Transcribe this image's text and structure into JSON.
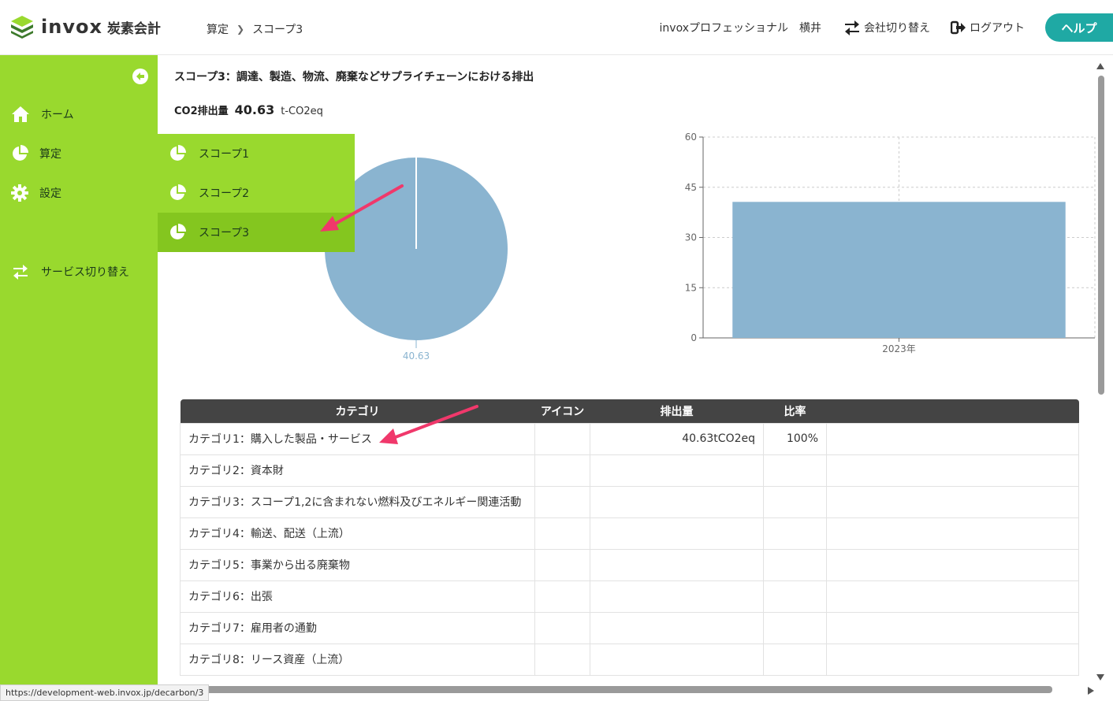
{
  "header": {
    "logo_word": "invox",
    "logo_sub": "炭素会計",
    "breadcrumb": [
      "算定",
      "スコープ3"
    ],
    "plan": "invoxプロフェッショナル",
    "user": "横井",
    "switch_company": "会社切り替え",
    "logout": "ログアウト",
    "help": "ヘルプ"
  },
  "sidebar": {
    "items": [
      {
        "label": "ホーム",
        "icon": "home-icon"
      },
      {
        "label": "算定",
        "icon": "pie-chart-icon"
      },
      {
        "label": "設定",
        "icon": "gear-icon"
      },
      {
        "label": "サービス切り替え",
        "icon": "switch-icon"
      }
    ],
    "submenu": [
      {
        "label": "スコープ1"
      },
      {
        "label": "スコープ2"
      },
      {
        "label": "スコープ3",
        "active": true
      }
    ]
  },
  "main": {
    "title": "スコープ3：調達、製造、物流、廃棄などサプライチェーンにおける排出",
    "co2_label": "CO2排出量",
    "co2_value": "40.63",
    "co2_unit": "t-CO2eq"
  },
  "chart_data": [
    {
      "type": "pie",
      "values": [
        40.63
      ],
      "labels": [
        "40.63"
      ],
      "color": "#8ab4d0"
    },
    {
      "type": "bar",
      "categories": [
        "2023年"
      ],
      "values": [
        40.63
      ],
      "ylim": [
        0,
        60
      ],
      "yticks": [
        0,
        15,
        30,
        45,
        60
      ],
      "grid": true,
      "color": "#8ab4d0"
    }
  ],
  "table": {
    "headers": [
      "カテゴリ",
      "アイコン",
      "排出量",
      "比率",
      ""
    ],
    "rows": [
      {
        "category": "カテゴリ1：購入した製品・サービス",
        "amount": "40.63tCO2eq",
        "ratio": "100%"
      },
      {
        "category": "カテゴリ2：資本財",
        "amount": "",
        "ratio": ""
      },
      {
        "category": "カテゴリ3：スコープ1,2に含まれない燃料及びエネルギー関連活動",
        "amount": "",
        "ratio": ""
      },
      {
        "category": "カテゴリ4：輸送、配送（上流）",
        "amount": "",
        "ratio": ""
      },
      {
        "category": "カテゴリ5：事業から出る廃棄物",
        "amount": "",
        "ratio": ""
      },
      {
        "category": "カテゴリ6：出張",
        "amount": "",
        "ratio": ""
      },
      {
        "category": "カテゴリ7：雇用者の通勤",
        "amount": "",
        "ratio": ""
      },
      {
        "category": "カテゴリ8：リース資産（上流）",
        "amount": "",
        "ratio": ""
      }
    ]
  },
  "status_url": "https://development-web.invox.jp/decarbon/3",
  "colors": {
    "sidebar": "#99d92e",
    "sidebar_active": "#84c61f",
    "accent": "#1fa9a4",
    "chart": "#8ab4d0",
    "arrow": "#f0386b"
  }
}
